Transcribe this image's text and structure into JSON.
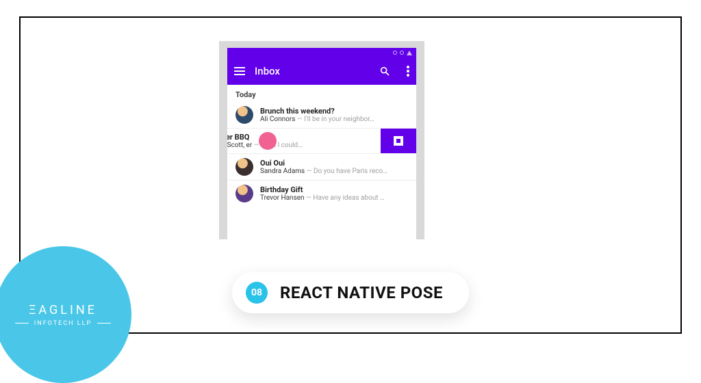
{
  "colors": {
    "primary": "#6200ea",
    "accent_pink": "#f06292",
    "brand_cyan": "#4ac7e8"
  },
  "appbar": {
    "title": "Inbox"
  },
  "section": {
    "label": "Today"
  },
  "mails": [
    {
      "subject": "Brunch this weekend?",
      "sender": "Ali Connors",
      "preview": "I'll be in your neighbor…"
    },
    {
      "subject": "Summer BBQ",
      "subject_visible": "immer BBQ",
      "sender": "Alex, Scott, Jeffer",
      "sender_visible": "Alex, Scott,        er",
      "preview": "Wish I could…"
    },
    {
      "subject": "Oui Oui",
      "sender": "Sandra Adams",
      "preview": "Do you have Paris reco…"
    },
    {
      "subject": "Birthday Gift",
      "sender": "Trevor Hansen",
      "preview": "Have any ideas about …"
    }
  ],
  "caption": {
    "number": "08",
    "title": "REACT NATIVE POSE"
  },
  "brand": {
    "name": "ΞAGLINE",
    "sub": "INFOTECH LLP"
  }
}
